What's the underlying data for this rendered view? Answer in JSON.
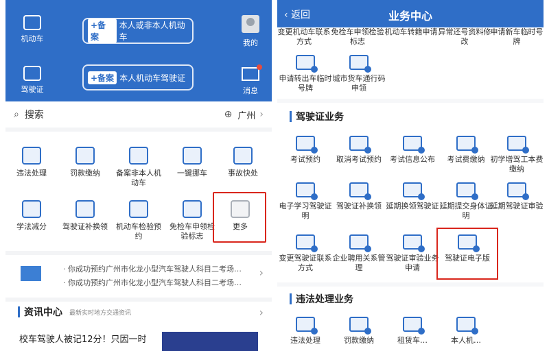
{
  "left": {
    "header": {
      "motor_vehicle": "机动车",
      "license": "驾驶证",
      "mine": "我的",
      "messages": "消息",
      "register_tag_1": "+备案",
      "register_text_1": "本人或非本人机动车",
      "register_tag_2": "+备案",
      "register_text_2": "本人机动车驾驶证"
    },
    "search": {
      "placeholder": "搜索",
      "city": "广州"
    },
    "grid": [
      "违法处理",
      "罚款缴纳",
      "备案非本人机动车",
      "一键挪车",
      "事故快处",
      "学法减分",
      "驾驶证补换领",
      "机动车检验预约",
      "免检车申领检验标志",
      "更多"
    ],
    "notices": [
      "· 你成功预约广州市化龙小型汽车驾驶人科目二考场…",
      "· 你成功预约广州市化龙小型汽车驾驶人科目二考场…"
    ],
    "news": {
      "title": "资讯中心",
      "subtitle": "最新实时地方交通资讯",
      "headline": "校车驾驶人被记12分！只因一时"
    }
  },
  "right": {
    "back": "返回",
    "title": "业务中心",
    "top_row": [
      "变更机动车联系方式",
      "免检车申领检验标志",
      "机动车转籍申请",
      "异常还号资料修改",
      "申请新车临时号牌"
    ],
    "second_row": [
      "申请转出车临时号牌",
      "城市货车通行码申领"
    ],
    "license_section": "驾驶证业务",
    "license_items": [
      "考试预约",
      "取消考试预约",
      "考试信息公布",
      "考试费缴纳",
      "初学增驾工本费缴纳",
      "电子学习驾驶证明",
      "驾驶证补换领",
      "延期换领驾驶证",
      "延期提交身体证明",
      "延期驾驶证审验",
      "变更驾驶证联系方式",
      "企业聘用关系管理",
      "驾驶证审验业务申请",
      "驾驶证电子版"
    ],
    "violation_section": "违法处理业务",
    "violation_items": [
      "违法处理",
      "罚款缴纳",
      "租赁车…",
      "本人机…"
    ]
  }
}
